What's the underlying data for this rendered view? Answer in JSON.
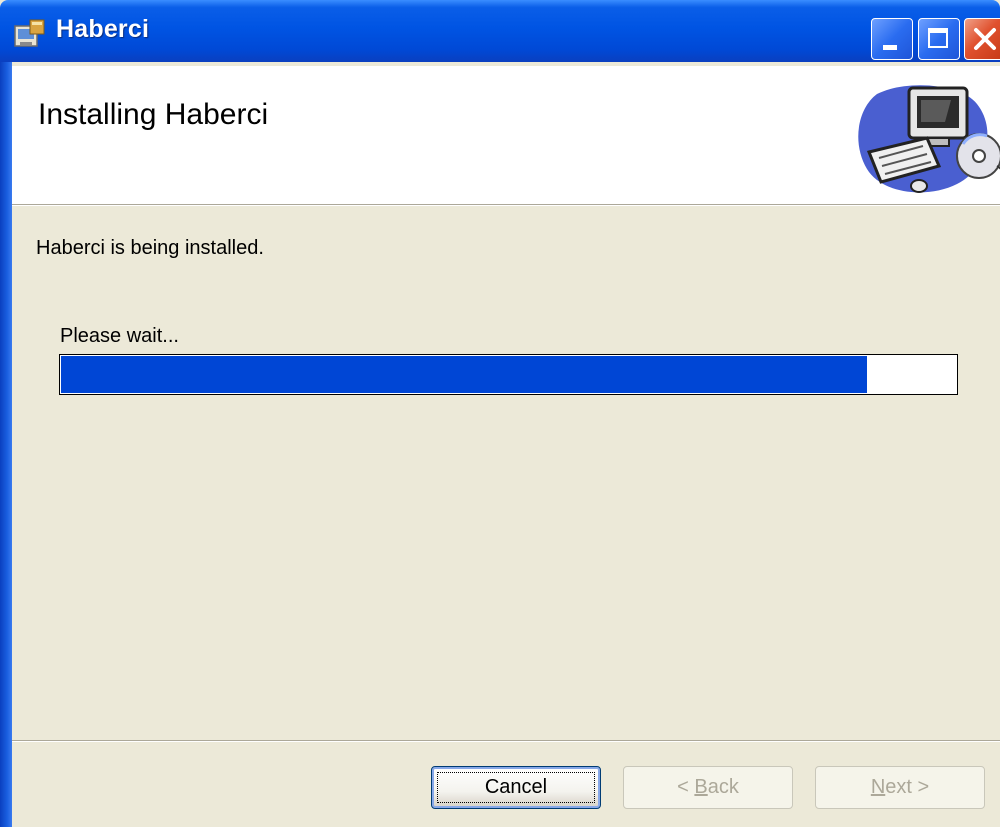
{
  "window": {
    "title": "Haberci",
    "controls": {
      "minimize_icon": "minimize-icon",
      "maximize_icon": "maximize-icon",
      "close_icon": "close-icon"
    }
  },
  "header": {
    "title": "Installing Haberci",
    "graphic_icon": "computer-setup-icon"
  },
  "body": {
    "status": "Haberci is being installed.",
    "wait_label": "Please wait...",
    "progress_fraction": 0.9
  },
  "buttons": {
    "cancel": "Cancel",
    "back": "< Back",
    "back_mnemonic": "B",
    "next": "Next >",
    "next_mnemonic": "N"
  },
  "colors": {
    "titlebar": "#0054e3",
    "progress_fill": "#0046d5",
    "dialog_bg": "#ece9d8"
  }
}
